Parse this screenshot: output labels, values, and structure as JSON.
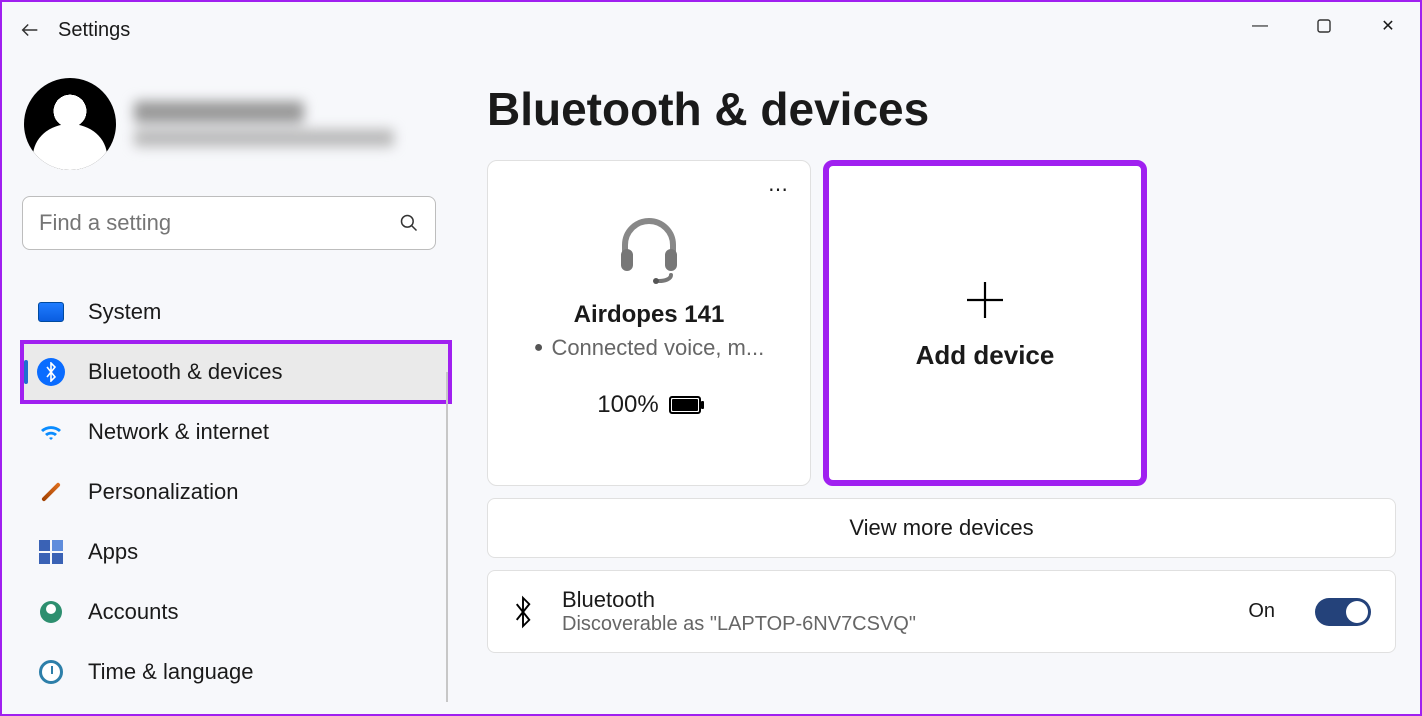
{
  "window": {
    "app_title": "Settings",
    "controls": {
      "minimize": "—",
      "maximize": "□",
      "close": "✕"
    }
  },
  "search": {
    "placeholder": "Find a setting"
  },
  "nav": {
    "items": [
      {
        "key": "system",
        "label": "System"
      },
      {
        "key": "bluetooth",
        "label": "Bluetooth & devices"
      },
      {
        "key": "network",
        "label": "Network & internet"
      },
      {
        "key": "personalization",
        "label": "Personalization"
      },
      {
        "key": "apps",
        "label": "Apps"
      },
      {
        "key": "accounts",
        "label": "Accounts"
      },
      {
        "key": "timelang",
        "label": "Time & language"
      }
    ],
    "selected_index": 1
  },
  "page": {
    "title": "Bluetooth & devices",
    "device": {
      "name": "Airdopes 141",
      "status": "Connected voice, m...",
      "battery": "100%"
    },
    "add_device_label": "Add device",
    "view_more_label": "View more devices",
    "bt_row": {
      "title": "Bluetooth",
      "subtitle": "Discoverable as \"LAPTOP-6NV7CSVQ\"",
      "toggle_label": "On",
      "toggle_on": true
    }
  }
}
